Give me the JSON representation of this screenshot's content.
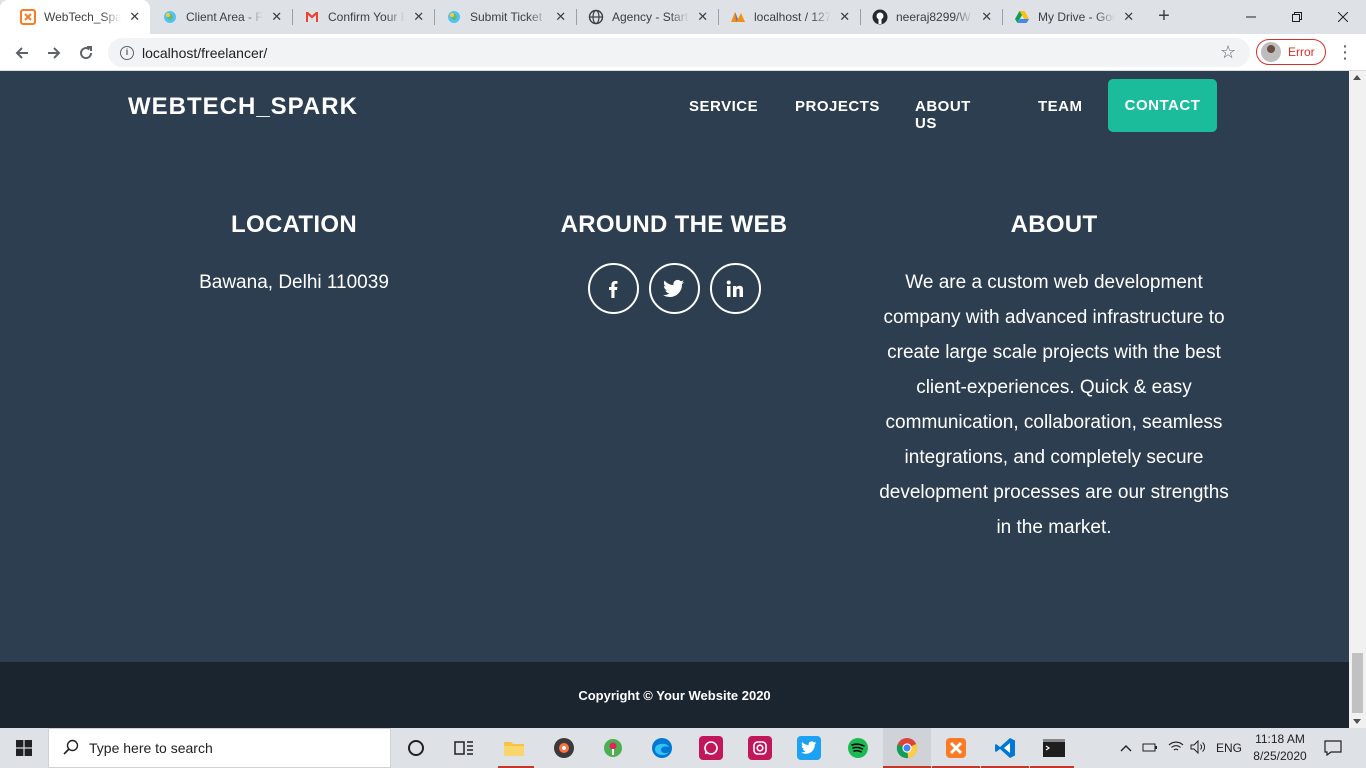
{
  "browser": {
    "tabs": [
      {
        "title": "WebTech_Spark",
        "icon": "xampp-icon",
        "active": true
      },
      {
        "title": "Client Area - Fr",
        "icon": "client-area-icon"
      },
      {
        "title": "Confirm Your R",
        "icon": "gmail-icon"
      },
      {
        "title": "Submit Ticket",
        "icon": "support-icon"
      },
      {
        "title": "Agency - Start",
        "icon": "globe-icon"
      },
      {
        "title": "localhost / 127",
        "icon": "phpmyadmin-icon"
      },
      {
        "title": "neeraj8299/W",
        "icon": "github-icon"
      },
      {
        "title": "My Drive - Goo",
        "icon": "google-drive-icon"
      }
    ],
    "url": "localhost/freelancer/",
    "profile_status": "Error"
  },
  "site": {
    "brand": "WEBTECH_SPARK",
    "nav": {
      "service": "SERVICE",
      "projects": "PROJECTS",
      "about": "ABOUT US",
      "team": "TEAM",
      "contact": "CONTACT"
    },
    "footer": {
      "location_title": "LOCATION",
      "location_text": "Bawana, Delhi 110039",
      "web_title": "AROUND THE WEB",
      "social": [
        {
          "label": "f",
          "icon": "facebook-icon"
        },
        {
          "label": "twitter",
          "icon": "twitter-icon"
        },
        {
          "label": "in",
          "icon": "linkedin-icon"
        }
      ],
      "about_title": "ABOUT",
      "about_text": "We are a custom web development company with advanced infrastructure to create large scale projects with the best client-experiences. Quick & easy communication, collaboration, seamless integrations, and completely secure development processes are our strengths in the market.",
      "copyright": "Copyright © Your Website 2020"
    },
    "colors": {
      "background": "#2c3e50",
      "footer_bottom": "#1a252f",
      "accent": "#1abc9c"
    }
  },
  "taskbar": {
    "search_placeholder": "Type here to search",
    "language": "ENG",
    "time": "11:18 AM",
    "date": "8/25/2020"
  }
}
